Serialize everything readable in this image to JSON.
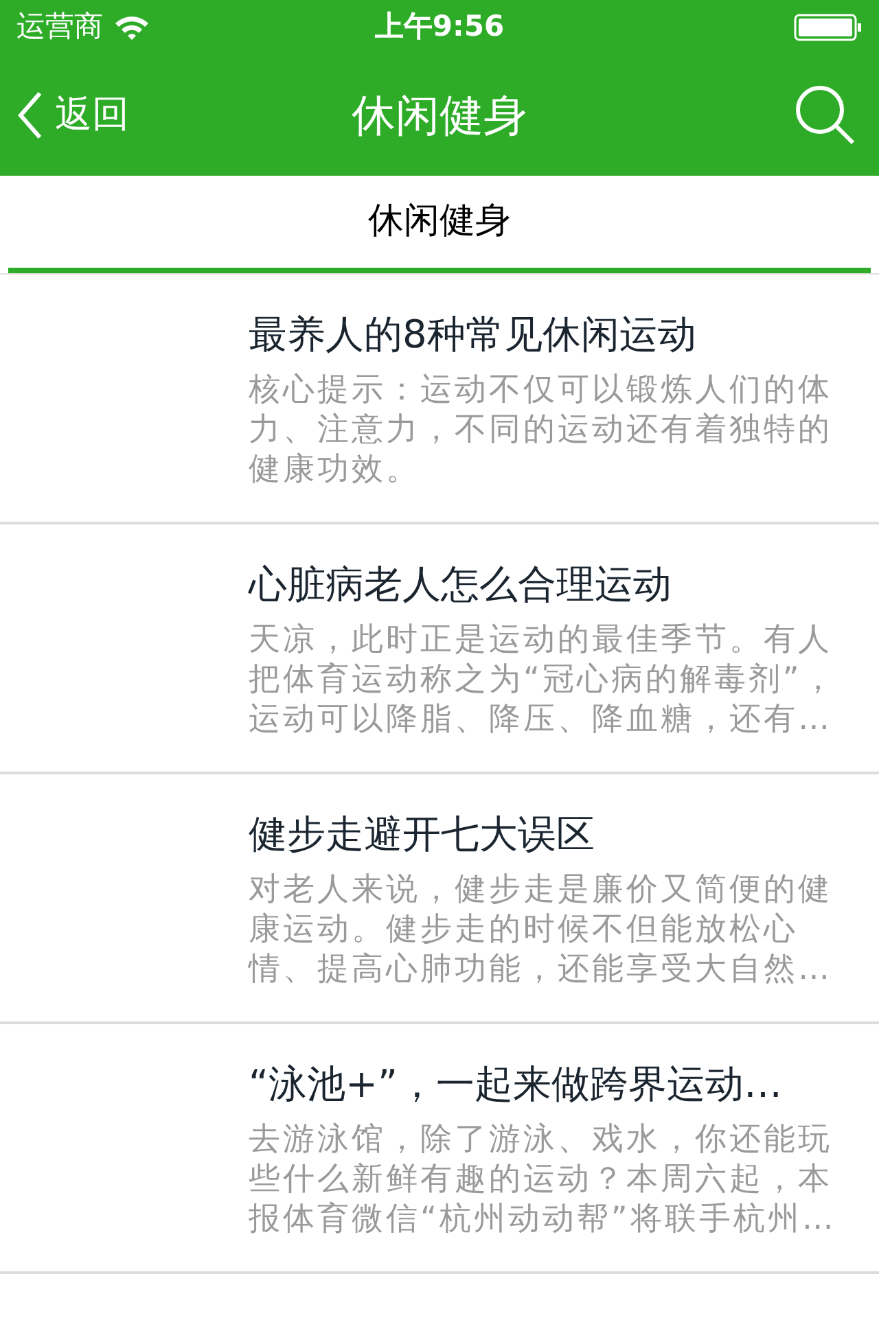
{
  "status_bar": {
    "carrier": "运营商",
    "time": "上午9:56"
  },
  "nav": {
    "back": "返回",
    "title": "休闲健身"
  },
  "tabs": [
    {
      "label": "休闲健身",
      "selected": true
    }
  ],
  "articles": [
    {
      "title": "最养人的8种常见休闲运动",
      "summary": "核心提示：运动不仅可以锻炼人们的体力、注意力，不同的运动还有着独特的健康功效。"
    },
    {
      "title": "心脏病老人怎么合理运动",
      "summary": "天凉，此时正是运动的最佳季节。有人把体育运动称之为“冠心病的解毒剂”，运动可以降脂、降压、降血糖，还有…"
    },
    {
      "title": "健步走避开七大误区",
      "summary": "对老人来说，健步走是廉价又简便的健康运动。健步走的时候不但能放松心情、提高心肺功能，还能享受大自然…"
    },
    {
      "title": "“泳池+”，一起来做跨界运动…",
      "summary": "去游泳馆，除了游泳、戏水，你还能玩些什么新鲜有趣的运动？本周六起，本报体育微信“杭州动动帮”将联手杭州…"
    }
  ]
}
